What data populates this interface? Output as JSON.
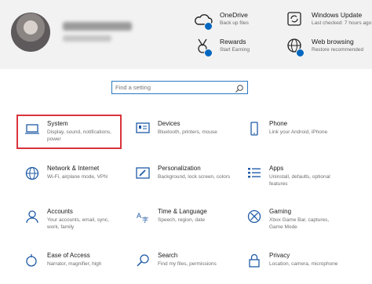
{
  "header": {
    "onedrive": {
      "title": "OneDrive",
      "sub": "Back up files",
      "icon": "cloud-icon"
    },
    "windows_update": {
      "title": "Windows Update",
      "sub": "Last checked: 7 hours ago",
      "icon": "refresh-icon"
    },
    "rewards": {
      "title": "Rewards",
      "sub": "Start Earning",
      "icon": "rewards-medal-icon"
    },
    "web_browsing": {
      "title": "Web browsing",
      "sub": "Restore recommended",
      "icon": "globe-icon"
    },
    "status_color": "#0067c0"
  },
  "search": {
    "placeholder": "Find a setting"
  },
  "highlight_color": "#d9343b",
  "tiles": [
    {
      "title": "System",
      "desc": "Display, sound, notifications, power",
      "icon": "laptop-icon"
    },
    {
      "title": "Devices",
      "desc": "Bluetooth, printers, mouse",
      "icon": "devices-icon"
    },
    {
      "title": "Phone",
      "desc": "Link your Android, iPhone",
      "icon": "phone-icon"
    },
    {
      "title": "Network & Internet",
      "desc": "Wi-Fi, airplane mode, VPN",
      "icon": "globe-icon"
    },
    {
      "title": "Personalization",
      "desc": "Background, lock screen, colors",
      "icon": "paintbrush-icon"
    },
    {
      "title": "Apps",
      "desc": "Uninstall, defaults, optional features",
      "icon": "apps-list-icon"
    },
    {
      "title": "Accounts",
      "desc": "Your accounts, email, sync, work, family",
      "icon": "person-icon"
    },
    {
      "title": "Time & Language",
      "desc": "Speech, region, date",
      "icon": "time-language-icon"
    },
    {
      "title": "Gaming",
      "desc": "Xbox Game Bar, captures, Game Mode",
      "icon": "xbox-icon"
    },
    {
      "title": "Ease of Access",
      "desc": "Narrator, magnifier, high",
      "icon": "ease-of-access-icon"
    },
    {
      "title": "Search",
      "desc": "Find my files, permissions",
      "icon": "search-icon"
    },
    {
      "title": "Privacy",
      "desc": "Location, camera, microphone",
      "icon": "lock-icon"
    }
  ]
}
